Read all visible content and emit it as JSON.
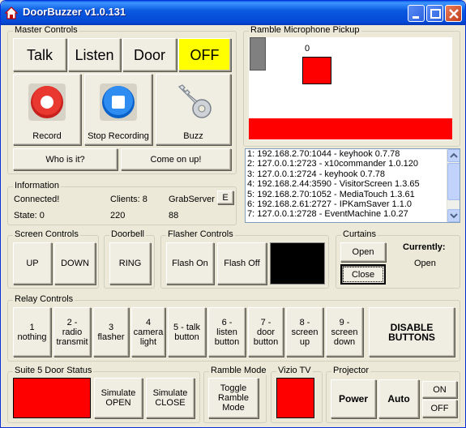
{
  "window": {
    "title": "DoorBuzzer v1.0.131"
  },
  "master": {
    "title": "Master Controls",
    "talk": "Talk",
    "listen": "Listen",
    "door": "Door",
    "off": "OFF",
    "record": "Record",
    "stop_recording": "Stop Recording",
    "buzz": "Buzz",
    "who_is_it": "Who is it?",
    "come_on_up": "Come on up!"
  },
  "mic": {
    "title": "Ramble Microphone Pickup",
    "level_value": "0"
  },
  "log": {
    "items": [
      "1: 192.168.2.70:1044 - keyhook 0.7.78",
      "2: 127.0.0.1:2723 - x10commander 1.0.120",
      "3: 127.0.0.1:2724 - keyhook 0.7.78",
      "4: 192.168.2.44:3590 - VisitorScreen 1.3.65",
      "5: 192.168.2.70:1052 - MediaTouch 1.3.61",
      "6: 192.168.2.61:2727 - IPKamSaver 1.1.0",
      "7: 127.0.0.1:2728 - EventMachine 1.0.27"
    ]
  },
  "info": {
    "title": "Information",
    "connected": "Connected!",
    "clients": "Clients: 8",
    "grabserver": "GrabServer (",
    "e_button": "E",
    "state": "State: 0",
    "clients_value": "220",
    "grab_value": "88"
  },
  "screen": {
    "title": "Screen Controls",
    "up": "UP",
    "down": "DOWN"
  },
  "doorbell": {
    "title": "Doorbell",
    "ring": "RING"
  },
  "flasher": {
    "title": "Flasher Controls",
    "on": "Flash On",
    "off": "Flash Off"
  },
  "curtains": {
    "title": "Curtains",
    "open": "Open",
    "close": "Close",
    "currently_label": "Currently:",
    "currently_value": "Open"
  },
  "relay": {
    "title": "Relay Controls",
    "buttons": [
      [
        "1",
        "nothing"
      ],
      [
        "2 -",
        "radio",
        "transmit"
      ],
      [
        "3",
        "flasher"
      ],
      [
        "4",
        "camera",
        "light"
      ],
      [
        "5 - talk",
        "button"
      ],
      [
        "6 -",
        "listen",
        "button"
      ],
      [
        "7 -",
        "door",
        "button"
      ],
      [
        "8 -",
        "screen",
        "up"
      ],
      [
        "9 -",
        "screen",
        "down"
      ]
    ],
    "disable": [
      "DISABLE",
      "BUTTONS"
    ]
  },
  "suite": {
    "title": "Suite 5 Door Status",
    "sim_open": [
      "Simulate",
      "OPEN"
    ],
    "sim_close": [
      "Simulate",
      "CLOSE"
    ]
  },
  "ramble": {
    "title": "Ramble Mode",
    "toggle": [
      "Toggle",
      "Ramble",
      "Mode"
    ]
  },
  "vizio": {
    "title": "Vizio TV"
  },
  "projector": {
    "title": "Projector",
    "power": "Power",
    "auto": "Auto",
    "on": "ON",
    "off": "OFF"
  },
  "colors": {
    "status_red": "#ff0000",
    "off_yellow": "#ffff00",
    "titlebar_blue": "#0449d6"
  }
}
